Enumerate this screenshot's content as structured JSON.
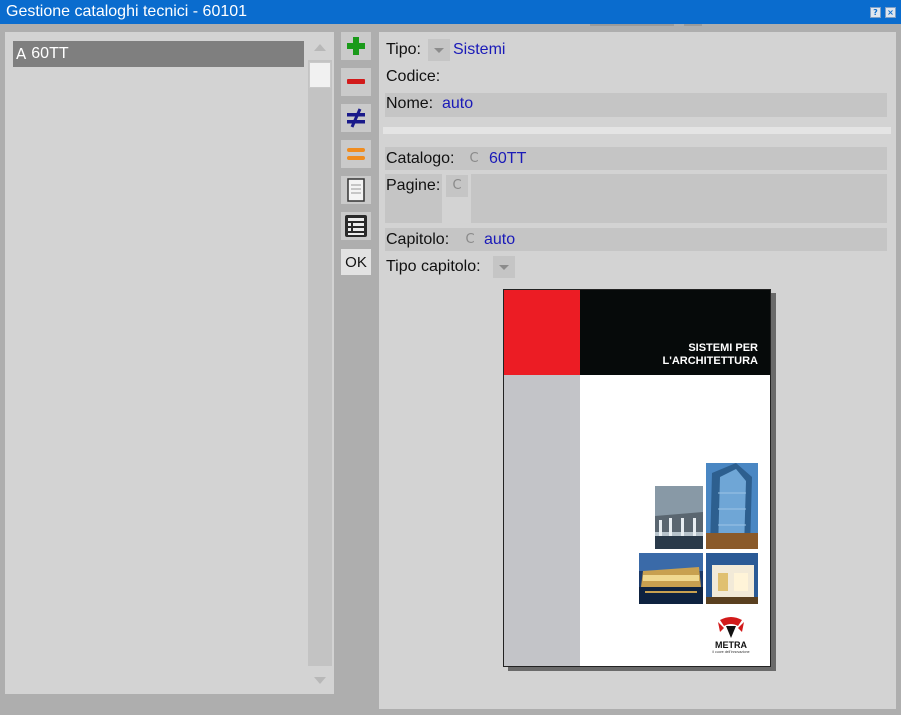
{
  "window": {
    "title": "Gestione cataloghi tecnici - 60101",
    "help_glyph": "?",
    "close_glyph": "×"
  },
  "list": {
    "items": [
      {
        "type_glyph": "A",
        "label": "60TT",
        "selected": true
      }
    ]
  },
  "toolbar": {
    "buttons": [
      {
        "name": "add-icon",
        "color": "#1a9a1a"
      },
      {
        "name": "remove-icon",
        "color": "#d21a1a"
      },
      {
        "name": "not-equal-icon",
        "color": "#1a1a8a"
      },
      {
        "name": "equal-icon",
        "color": "#f08c1e"
      },
      {
        "name": "page-icon"
      },
      {
        "name": "list-icon"
      }
    ],
    "ok_label": "OK"
  },
  "form": {
    "tipo": {
      "label": "Tipo:",
      "value": "Sistemi"
    },
    "codice": {
      "label": "Codice:",
      "value": ""
    },
    "nome": {
      "label": "Nome:",
      "value": "auto"
    },
    "catalogo": {
      "label": "Catalogo:",
      "button": "C",
      "value": "60TT"
    },
    "pagine": {
      "label": "Pagine:",
      "button": "C",
      "value": ""
    },
    "capitolo": {
      "label": "Capitolo:",
      "button": "C",
      "value": "auto"
    },
    "tipo_capitolo": {
      "label": "Tipo capitolo:",
      "value": ""
    }
  },
  "cover": {
    "title_line1": "SISTEMI PER",
    "title_line2": "L'ARCHITETTURA",
    "logo_text": "METRA",
    "logo_sub": "il cuore dell'innovazione",
    "colors": {
      "red": "#ec1c24",
      "black": "#060a0a",
      "grey": "#c3c4c8"
    }
  }
}
